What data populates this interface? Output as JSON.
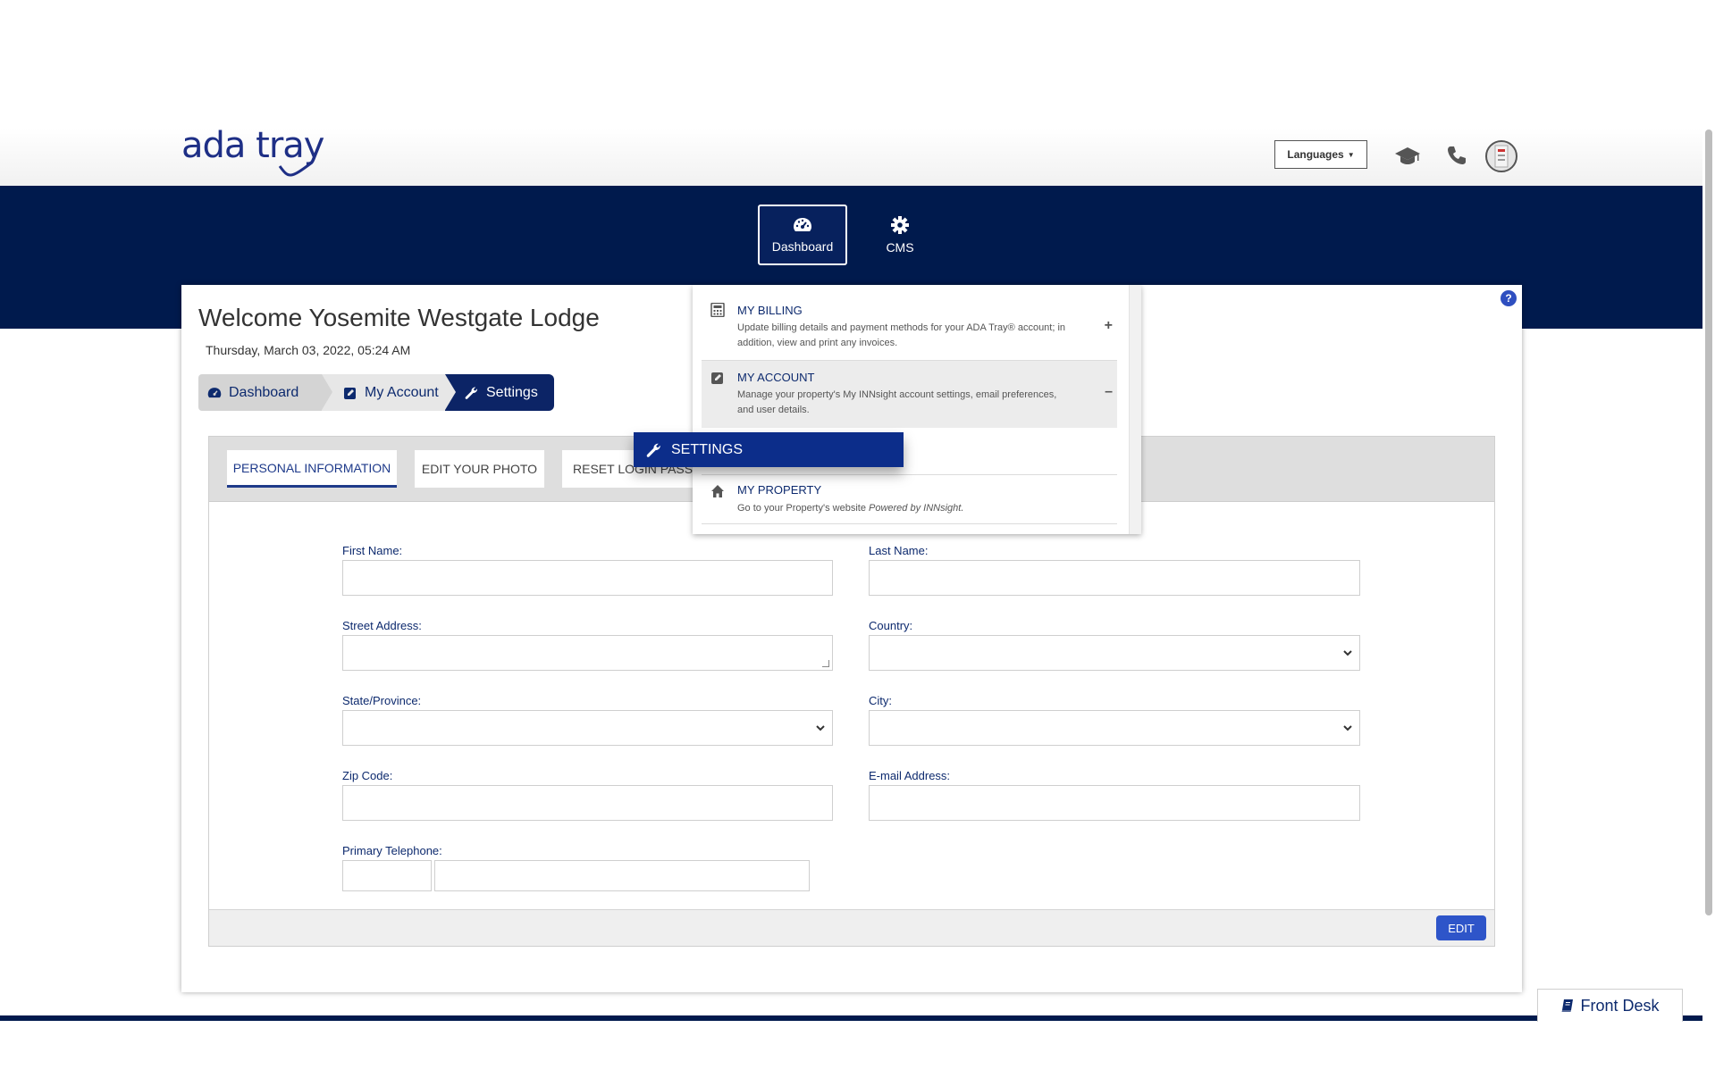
{
  "header": {
    "logo_text": "ada tray",
    "languages_label": "Languages",
    "icons": [
      "graduation-cap-icon",
      "phone-icon",
      "avatar"
    ]
  },
  "nav": {
    "items": [
      {
        "label": "Dashboard",
        "icon": "dashboard-icon",
        "active": true
      },
      {
        "label": "CMS",
        "icon": "gear-icon",
        "active": false
      }
    ]
  },
  "page": {
    "welcome": "Welcome Yosemite Westgate Lodge",
    "date": "Thursday, March 03, 2022, 05:24 AM"
  },
  "breadcrumb": [
    {
      "label": "Dashboard",
      "icon": "dashboard-icon"
    },
    {
      "label": "My Account",
      "icon": "edit-icon"
    },
    {
      "label": "Settings",
      "icon": "wrench-icon"
    }
  ],
  "tabs": [
    {
      "label": "PERSONAL INFORMATION",
      "active": true
    },
    {
      "label": "EDIT YOUR PHOTO",
      "active": false
    },
    {
      "label": "RESET LOGIN PASSW",
      "active": false
    }
  ],
  "form": {
    "first_name_label": "First Name:",
    "last_name_label": "Last Name:",
    "street_label": "Street Address:",
    "country_label": "Country:",
    "state_label": "State/Province:",
    "city_label": "City:",
    "zip_label": "Zip Code:",
    "email_label": "E-mail Address:",
    "phone_label": "Primary Telephone:",
    "edit_label": "EDIT"
  },
  "menu": {
    "billing": {
      "title": "MY BILLING",
      "desc": "Update billing details and payment methods for your ADA Tray® account; in addition, view and print any invoices.",
      "toggle": "+"
    },
    "account": {
      "title": "MY ACCOUNT",
      "desc": "Manage your property's My INNsight account settings, email preferences, and user details.",
      "toggle": "–"
    },
    "settings_label": "SETTINGS",
    "property": {
      "title": "MY PROPERTY",
      "desc_prefix": "Go to your Property's website ",
      "desc_em": "Powered by INNsight."
    }
  },
  "footer": {
    "front_desk": "Front Desk"
  },
  "colors": {
    "navy": "#001a4d",
    "accent_blue": "#2e55c9",
    "settings_blue": "#0c2d8a"
  }
}
